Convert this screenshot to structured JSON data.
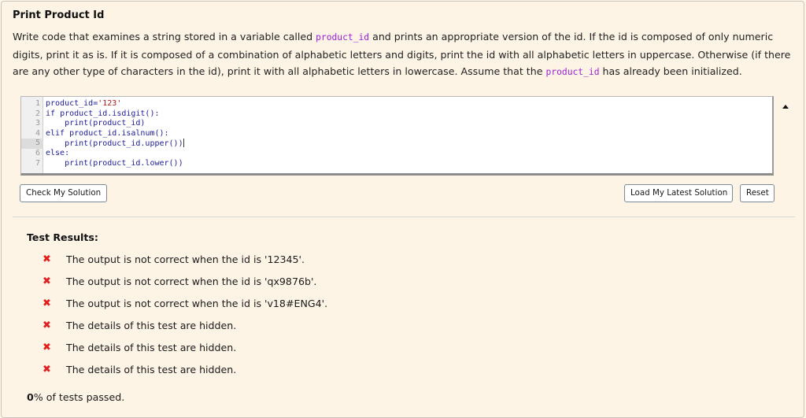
{
  "title": "Print Product Id",
  "description": {
    "p1": "Write code that examines a string stored in a variable called ",
    "code1": "product_id",
    "p2": " and prints an appropriate version of the id. If the id is composed of only numeric digits, print it as is. If it is composed of a combination of alphabetic letters and digits, print the id with all alphabetic letters in uppercase. Otherwise (if there are any other type of characters in the id), print it with all alphabetic letters in lowercase. Assume that the ",
    "code2": "product_id",
    "p3": " has already been initialized."
  },
  "editor": {
    "active_line": 5,
    "lines": [
      {
        "num": "1",
        "text": "product_id='123'"
      },
      {
        "num": "2",
        "text": "if product_id.isdigit():"
      },
      {
        "num": "3",
        "text": "    print(product_id)"
      },
      {
        "num": "4",
        "text": "elif product_id.isalnum():"
      },
      {
        "num": "5",
        "text": "    print(product_id.upper())"
      },
      {
        "num": "6",
        "text": "else:"
      },
      {
        "num": "7",
        "text": "    print(product_id.lower())"
      }
    ],
    "scroll_icon": "triangle-up"
  },
  "buttons": {
    "check": "Check My Solution",
    "load": "Load My Latest Solution",
    "reset": "Reset"
  },
  "results": {
    "heading": "Test Results:",
    "fail_icon": "✖",
    "fail_color": "#e01f1f",
    "items": [
      {
        "status": "fail",
        "message": "The output is not correct when the id is '12345'."
      },
      {
        "status": "fail",
        "message": "The output is not correct when the id is 'qx9876b'."
      },
      {
        "status": "fail",
        "message": "The output is not correct when the id is 'v18#ENG4'."
      },
      {
        "status": "fail",
        "message": "The details of this test are hidden."
      },
      {
        "status": "fail",
        "message": "The details of this test are hidden."
      },
      {
        "status": "fail",
        "message": "The details of this test are hidden."
      }
    ],
    "percent_passed": "0",
    "summary_suffix": "% of tests passed."
  }
}
